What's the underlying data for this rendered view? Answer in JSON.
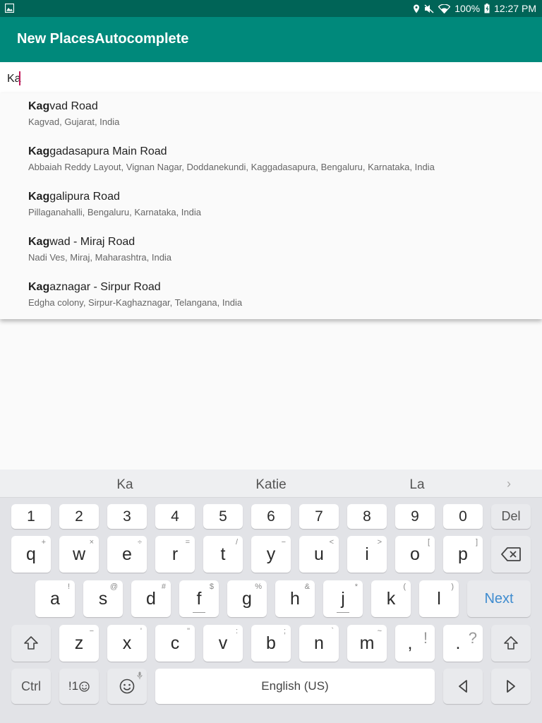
{
  "status_bar": {
    "battery": "100%",
    "time": "12:27 PM"
  },
  "app_bar": {
    "title": "New PlacesAutocomplete"
  },
  "search": {
    "query": "Ka"
  },
  "suggestions": [
    {
      "match": "Kag",
      "rest": "vad Road",
      "secondary": "Kagvad, Gujarat, India"
    },
    {
      "match": "Kag",
      "rest": "gadasapura Main Road",
      "secondary": "Abbaiah Reddy Layout, Vignan Nagar, Doddanekundi, Kaggadasapura, Bengaluru, Karnataka, India"
    },
    {
      "match": "Kag",
      "rest": "galipura Road",
      "secondary": "Pillaganahalli, Bengaluru, Karnataka, India"
    },
    {
      "match": "Kag",
      "rest": "wad - Miraj Road",
      "secondary": "Nadi Ves, Miraj, Maharashtra, India"
    },
    {
      "match": "Kag",
      "rest": "aznagar - Sirpur Road",
      "secondary": "Edgha colony, Sirpur-Kaghaznagar, Telangana, India"
    }
  ],
  "keyboard": {
    "word_suggestions": [
      "Ka",
      "Katie",
      "La"
    ],
    "number_row": [
      "1",
      "2",
      "3",
      "4",
      "5",
      "6",
      "7",
      "8",
      "9",
      "0"
    ],
    "del_label": "Del",
    "row_q": [
      {
        "k": "q",
        "s": "+"
      },
      {
        "k": "w",
        "s": "×"
      },
      {
        "k": "e",
        "s": "÷"
      },
      {
        "k": "r",
        "s": "="
      },
      {
        "k": "t",
        "s": "/"
      },
      {
        "k": "y",
        "s": "−"
      },
      {
        "k": "u",
        "s": "<"
      },
      {
        "k": "i",
        "s": ">"
      },
      {
        "k": "o",
        "s": "["
      },
      {
        "k": "p",
        "s": "]"
      }
    ],
    "row_a": [
      {
        "k": "a",
        "s": "!"
      },
      {
        "k": "s",
        "s": "@"
      },
      {
        "k": "d",
        "s": "#"
      },
      {
        "k": "f",
        "s": "$"
      },
      {
        "k": "g",
        "s": "%"
      },
      {
        "k": "h",
        "s": "&"
      },
      {
        "k": "j",
        "s": "*"
      },
      {
        "k": "k",
        "s": "("
      },
      {
        "k": "l",
        "s": ")"
      }
    ],
    "next_label": "Next",
    "row_z": [
      {
        "k": "z",
        "s": "−"
      },
      {
        "k": "x",
        "s": "'"
      },
      {
        "k": "c",
        "s": "\""
      },
      {
        "k": "v",
        "s": ":"
      },
      {
        "k": "b",
        "s": ";"
      },
      {
        "k": "n",
        "s": "`"
      },
      {
        "k": "m",
        "s": "~"
      }
    ],
    "comma": ",",
    "comma_sub": "!",
    "period": ".",
    "period_sub": "?",
    "ctrl_label": "Ctrl",
    "symbols_label": "!1",
    "space_label": "English (US)"
  }
}
